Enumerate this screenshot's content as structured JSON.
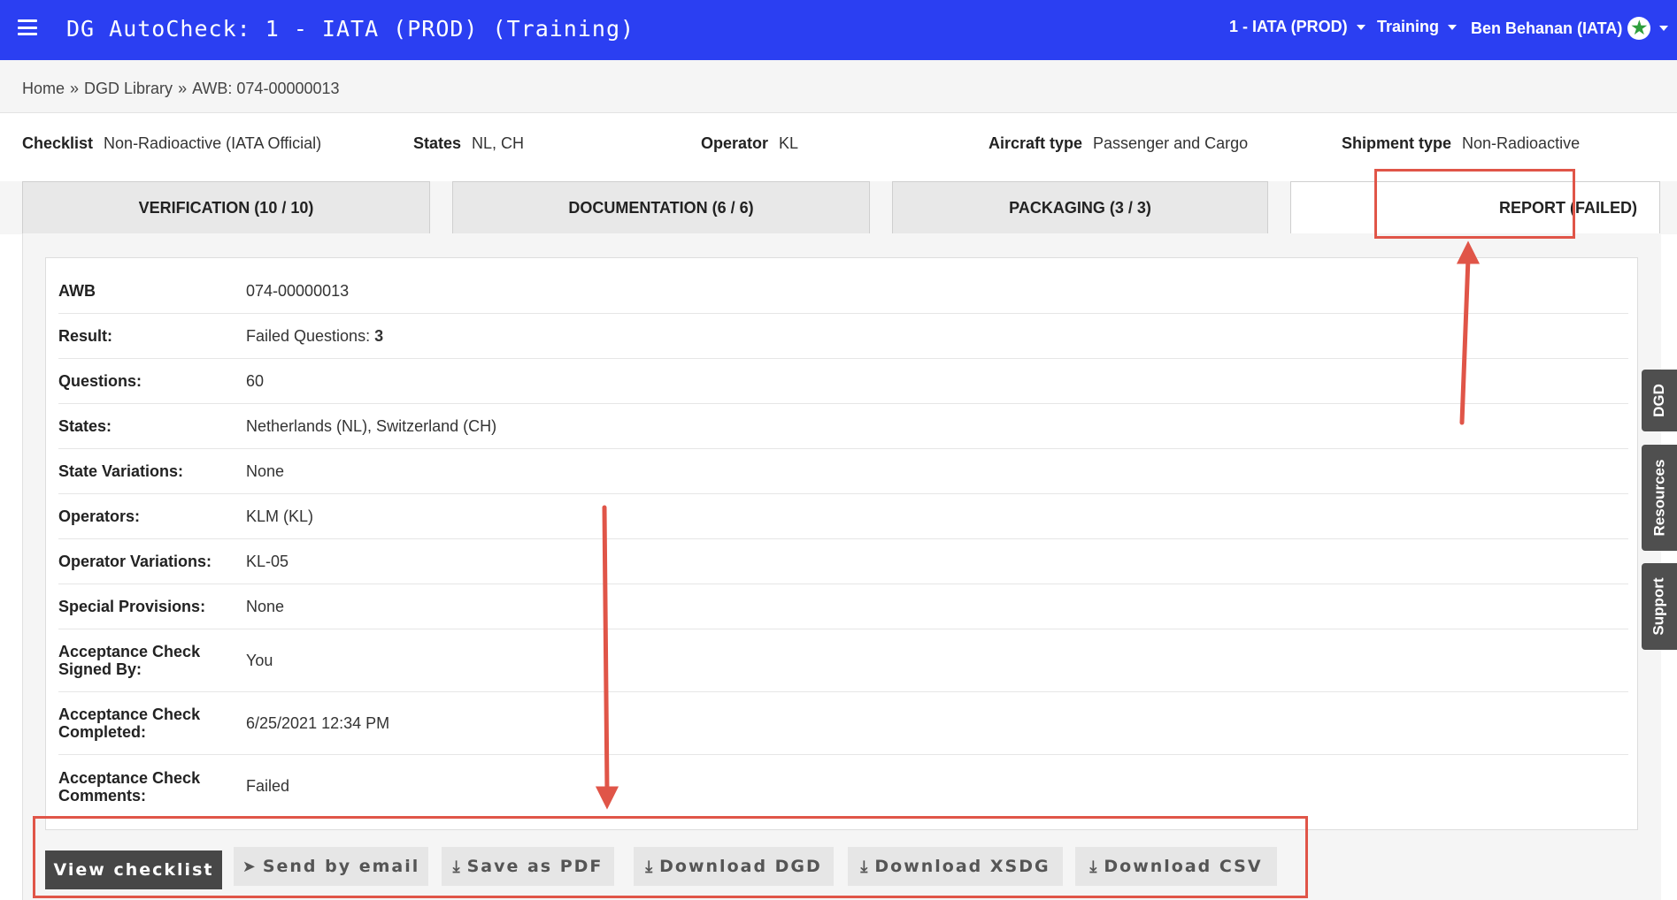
{
  "header": {
    "app_title": "DG AutoCheck: 1 - IATA (PROD) (Training)",
    "org_menu": "1 - IATA (PROD)",
    "mode_menu": "Training",
    "user_menu": "Ben Behanan (IATA)",
    "brand_color": "#2b3ff2"
  },
  "breadcrumb": {
    "home": "Home",
    "library": "DGD Library",
    "current": "AWB: 074-00000013",
    "separator": "»"
  },
  "meta": {
    "checklist_label": "Checklist",
    "checklist_value": "Non-Radioactive (IATA Official)",
    "states_label": "States",
    "states_value": "NL, CH",
    "operator_label": "Operator",
    "operator_value": "KL",
    "aircraft_label": "Aircraft type",
    "aircraft_value": "Passenger and Cargo",
    "shipment_label": "Shipment type",
    "shipment_value": "Non-Radioactive"
  },
  "tabs": [
    {
      "label": "VERIFICATION (10 / 10)"
    },
    {
      "label": "DOCUMENTATION (6 / 6)"
    },
    {
      "label": "PACKAGING (3 / 3)"
    },
    {
      "label": "REPORT (FAILED)",
      "active": true
    }
  ],
  "report": {
    "awb_label": "AWB",
    "awb_value": "074-00000013",
    "result_label": "Result:",
    "result_prefix": "Failed Questions: ",
    "result_count": "3",
    "questions_label": "Questions:",
    "questions_value": "60",
    "states_label": "States:",
    "states_value": "Netherlands (NL), Switzerland (CH)",
    "state_var_label": "State Variations:",
    "state_var_value": "None",
    "operators_label": "Operators:",
    "operators_value": "KLM (KL)",
    "op_var_label": "Operator Variations:",
    "op_var_value": "KL-05",
    "special_label": "Special Provisions:",
    "special_value": "None",
    "signed_label": "Acceptance Check Signed By:",
    "signed_value": "You",
    "completed_label": "Acceptance Check Completed:",
    "completed_value": "6/25/2021 12:34 PM",
    "comments_label": "Acceptance Check Comments:",
    "comments_value": "Failed"
  },
  "actions": {
    "view_checklist": "View checklist",
    "send_email": "Send by email",
    "save_pdf": "Save as PDF",
    "download_dgd": "Download DGD",
    "download_xsdg": "Download XSDG",
    "download_csv": "Download CSV"
  },
  "side_tabs": {
    "dgd": "DGD",
    "resources": "Resources",
    "support": "Support"
  },
  "annotation_color": "#e05548"
}
